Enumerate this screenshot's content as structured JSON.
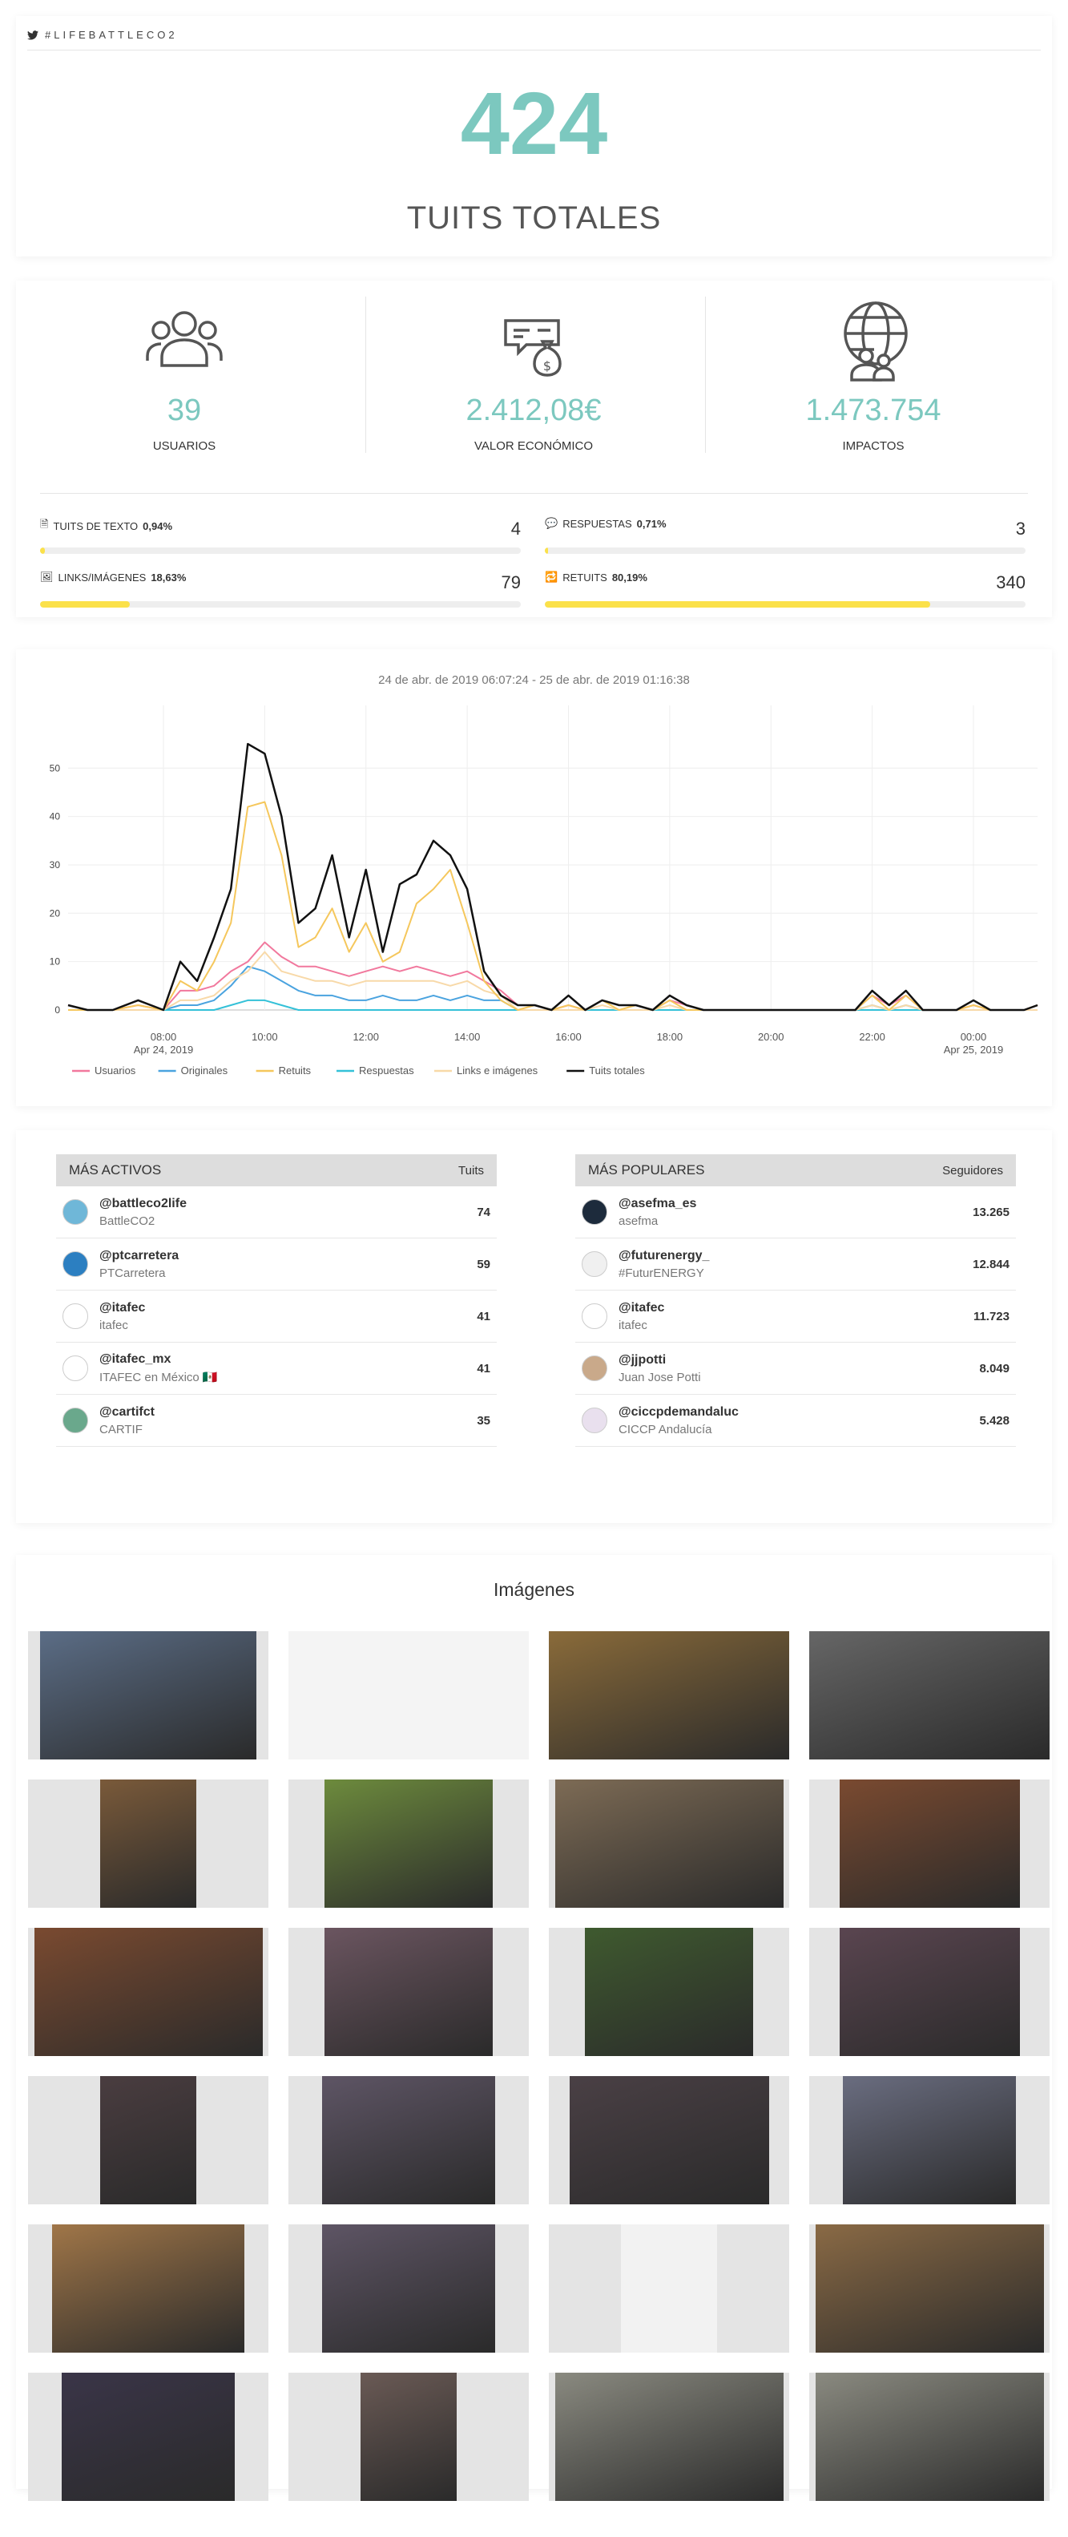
{
  "header": {
    "hashtag": "#LIFEBATTLECO2",
    "total_value": "424",
    "total_label": "TUITS TOTALES"
  },
  "stats": [
    {
      "icon": "users-icon",
      "value": "39",
      "label": "USUARIOS"
    },
    {
      "icon": "money-icon",
      "value": "2.412,08€",
      "label": "VALOR ECONÓMICO"
    },
    {
      "icon": "globe-users-icon",
      "value": "1.473.754",
      "label": "IMPACTOS"
    }
  ],
  "metrics": [
    {
      "icon": "document-icon",
      "label": "TUITS DE TEXTO",
      "pct": "0,94%",
      "value": "4",
      "fill": 0.0094
    },
    {
      "icon": "comments-icon",
      "label": "RESPUESTAS",
      "pct": "0,71%",
      "value": "3",
      "fill": 0.0071
    },
    {
      "icon": "image-icon",
      "label": "LINKS/IMÁGENES",
      "pct": "18,63%",
      "value": "79",
      "fill": 0.1863
    },
    {
      "icon": "retweet-icon",
      "label": "RETUITS",
      "pct": "80,19%",
      "value": "340",
      "fill": 0.8019
    }
  ],
  "chart_data": {
    "type": "line",
    "title": "24 de abr. de 2019 06:07:24 - 25 de abr. de 2019 01:16:38",
    "x_start": "2019-04-24 06:00",
    "x_ticks": [
      {
        "x": "2019-04-24 08:00",
        "label": "08:00",
        "sub": "Apr 24, 2019"
      },
      {
        "x": "2019-04-24 10:00",
        "label": "10:00",
        "sub": ""
      },
      {
        "x": "2019-04-24 12:00",
        "label": "12:00",
        "sub": ""
      },
      {
        "x": "2019-04-24 14:00",
        "label": "14:00",
        "sub": ""
      },
      {
        "x": "2019-04-24 16:00",
        "label": "16:00",
        "sub": ""
      },
      {
        "x": "2019-04-24 18:00",
        "label": "18:00",
        "sub": ""
      },
      {
        "x": "2019-04-24 20:00",
        "label": "20:00",
        "sub": ""
      },
      {
        "x": "2019-04-24 22:00",
        "label": "22:00",
        "sub": ""
      },
      {
        "x": "2019-04-25 00:00",
        "label": "00:00",
        "sub": "Apr 25, 2019"
      }
    ],
    "x_end": "2019-04-25 01:15",
    "y_ticks": [
      0,
      10,
      20,
      30,
      40,
      50
    ],
    "ylim": [
      0,
      58
    ],
    "grid": true,
    "legend_position": "bottom-left",
    "x": [
      "06:07",
      "06:30",
      "07:00",
      "07:30",
      "08:00",
      "08:20",
      "08:40",
      "09:00",
      "09:20",
      "09:40",
      "10:00",
      "10:20",
      "10:40",
      "11:00",
      "11:20",
      "11:40",
      "12:00",
      "12:20",
      "12:40",
      "13:00",
      "13:20",
      "13:40",
      "14:00",
      "14:20",
      "14:40",
      "15:00",
      "15:20",
      "15:40",
      "16:00",
      "16:20",
      "16:40",
      "17:00",
      "17:20",
      "17:40",
      "18:00",
      "18:20",
      "18:40",
      "19:00",
      "20:00",
      "21:00",
      "21:40",
      "22:00",
      "22:20",
      "22:40",
      "23:00",
      "23:20",
      "23:40",
      "00:00",
      "00:20",
      "00:40",
      "01:00",
      "01:16"
    ],
    "series": [
      {
        "name": "Usuarios",
        "color": "#f1789d",
        "values": [
          1,
          0,
          0,
          1,
          0,
          4,
          4,
          5,
          8,
          10,
          14,
          11,
          9,
          9,
          8,
          7,
          8,
          9,
          8,
          9,
          8,
          7,
          8,
          6,
          4,
          1,
          1,
          0,
          1,
          0,
          2,
          1,
          1,
          0,
          2,
          1,
          0,
          0,
          0,
          0,
          0,
          3,
          1,
          3,
          0,
          0,
          0,
          1,
          0,
          0,
          0,
          1
        ]
      },
      {
        "name": "Originales",
        "color": "#4aa3df",
        "values": [
          0,
          0,
          0,
          0,
          0,
          1,
          1,
          2,
          5,
          9,
          8,
          6,
          4,
          3,
          3,
          2,
          2,
          3,
          2,
          2,
          3,
          2,
          3,
          2,
          2,
          0,
          0,
          0,
          0,
          0,
          0,
          0,
          0,
          0,
          0,
          0,
          0,
          0,
          0,
          0,
          0,
          1,
          0,
          1,
          0,
          0,
          0,
          0,
          0,
          0,
          0,
          0
        ]
      },
      {
        "name": "Retuits",
        "color": "#f5c75c",
        "values": [
          0,
          0,
          0,
          1,
          0,
          6,
          4,
          10,
          18,
          42,
          43,
          32,
          13,
          15,
          21,
          12,
          18,
          10,
          12,
          22,
          25,
          29,
          18,
          6,
          2,
          0,
          1,
          0,
          1,
          0,
          2,
          0,
          1,
          0,
          2,
          0,
          0,
          0,
          0,
          0,
          0,
          3,
          0,
          3,
          0,
          0,
          0,
          1,
          0,
          0,
          0,
          1
        ]
      },
      {
        "name": "Respuestas",
        "color": "#34c1d8",
        "values": [
          0,
          0,
          0,
          0,
          0,
          0,
          0,
          0,
          1,
          2,
          2,
          1,
          0,
          0,
          0,
          0,
          0,
          0,
          0,
          0,
          0,
          0,
          0,
          0,
          0,
          0,
          0,
          0,
          0,
          0,
          0,
          0,
          0,
          0,
          0,
          0,
          0,
          0,
          0,
          0,
          0,
          0,
          0,
          0,
          0,
          0,
          0,
          0,
          0,
          0,
          0,
          0
        ]
      },
      {
        "name": "Links e imágenes",
        "color": "#f8d9a8",
        "values": [
          0,
          0,
          0,
          0,
          0,
          2,
          2,
          3,
          6,
          8,
          12,
          8,
          7,
          6,
          6,
          5,
          6,
          6,
          6,
          6,
          6,
          5,
          6,
          4,
          3,
          0,
          0,
          0,
          0,
          0,
          1,
          0,
          0,
          0,
          1,
          0,
          0,
          0,
          0,
          0,
          0,
          1,
          0,
          1,
          0,
          0,
          0,
          0,
          0,
          0,
          0,
          0
        ]
      },
      {
        "name": "Tuits totales",
        "color": "#111111",
        "values": [
          1,
          0,
          0,
          2,
          0,
          10,
          6,
          15,
          25,
          55,
          53,
          40,
          18,
          21,
          32,
          15,
          29,
          12,
          26,
          28,
          35,
          32,
          25,
          8,
          3,
          1,
          1,
          0,
          3,
          0,
          2,
          1,
          1,
          0,
          3,
          1,
          0,
          0,
          0,
          0,
          0,
          4,
          1,
          4,
          0,
          0,
          0,
          2,
          0,
          0,
          0,
          1
        ]
      }
    ]
  },
  "tables": {
    "active": {
      "title": "MÁS ACTIVOS",
      "col": "Tuits",
      "rows": [
        {
          "user": "@battleco2life",
          "name": "BattleCO2",
          "value": "74",
          "color": "#6fb7d8"
        },
        {
          "user": "@ptcarretera",
          "name": "PTCarretera",
          "value": "59",
          "color": "#2c7fc1"
        },
        {
          "user": "@itafec",
          "name": "itafec",
          "value": "41",
          "color": "#ffffff"
        },
        {
          "user": "@itafec_mx",
          "name": "ITAFEC en México 🇲🇽",
          "value": "41",
          "color": "#ffffff"
        },
        {
          "user": "@cartifct",
          "name": "CARTIF",
          "value": "35",
          "color": "#6aa88c"
        }
      ]
    },
    "popular": {
      "title": "MÁS POPULARES",
      "col": "Seguidores",
      "rows": [
        {
          "user": "@asefma_es",
          "name": "asefma",
          "value": "13.265",
          "color": "#1d2b3c"
        },
        {
          "user": "@futurenergy_",
          "name": "#FuturENERGY",
          "value": "12.844",
          "color": "#f0f0f0"
        },
        {
          "user": "@itafec",
          "name": "itafec",
          "value": "11.723",
          "color": "#ffffff"
        },
        {
          "user": "@jjpotti",
          "name": "Juan Jose Potti",
          "value": "8.049",
          "color": "#c9a98a"
        },
        {
          "user": "@ciccpdemandaluc",
          "name": "CICCP Andalucía",
          "value": "5.428",
          "color": "#e9e0ee"
        }
      ]
    }
  },
  "images": {
    "title": "Imágenes",
    "items": [
      {
        "desc": "building-photo",
        "fill": 0.9,
        "color": "#5b6d86"
      },
      {
        "desc": "website-mockup",
        "fill": 1.0,
        "color": "#f4f4f4"
      },
      {
        "desc": "highway-banner",
        "fill": 1.0,
        "color": "#8a6b3a"
      },
      {
        "desc": "event-banner",
        "fill": 1.0,
        "color": "#666666"
      },
      {
        "desc": "manual-cover",
        "fill": 0.4,
        "color": "#7a5a3a"
      },
      {
        "desc": "slide-photo",
        "fill": 0.7,
        "color": "#6d8b3d"
      },
      {
        "desc": "speaker-photo",
        "fill": 0.95,
        "color": "#7d6b55"
      },
      {
        "desc": "conference-photo",
        "fill": 0.75,
        "color": "#7a4a30"
      },
      {
        "desc": "panel-photo",
        "fill": 0.95,
        "color": "#7a4a30"
      },
      {
        "desc": "presentation-photo",
        "fill": 0.7,
        "color": "#6b5560"
      },
      {
        "desc": "road-photo",
        "fill": 0.7,
        "color": "#3f5a2f"
      },
      {
        "desc": "presentation-photo-2",
        "fill": 0.75,
        "color": "#5a4550"
      },
      {
        "desc": "speaker-photo-2",
        "fill": 0.4,
        "color": "#4a3d40"
      },
      {
        "desc": "presentation-photo-3",
        "fill": 0.72,
        "color": "#5e5565"
      },
      {
        "desc": "audience-photo",
        "fill": 0.83,
        "color": "#4a4045"
      },
      {
        "desc": "presentation-photo-4",
        "fill": 0.72,
        "color": "#6a6d80"
      },
      {
        "desc": "wood-chips-photo",
        "fill": 0.8,
        "color": "#a07648"
      },
      {
        "desc": "presentation-photo-5",
        "fill": 0.72,
        "color": "#5e5565"
      },
      {
        "desc": "document-photo",
        "fill": 0.4,
        "color": "#f2f2f2"
      },
      {
        "desc": "wood-chips-truck-photo",
        "fill": 0.95,
        "color": "#8a6a45"
      },
      {
        "desc": "presentation-photo-6",
        "fill": 0.72,
        "color": "#3a3548"
      },
      {
        "desc": "presentation-photo-7",
        "fill": 0.4,
        "color": "#6a5a55"
      },
      {
        "desc": "plant-aerial-photo",
        "fill": 0.95,
        "color": "#8a8a80"
      },
      {
        "desc": "plant-aerial-photo-2",
        "fill": 0.95,
        "color": "#8a8a80"
      }
    ]
  }
}
